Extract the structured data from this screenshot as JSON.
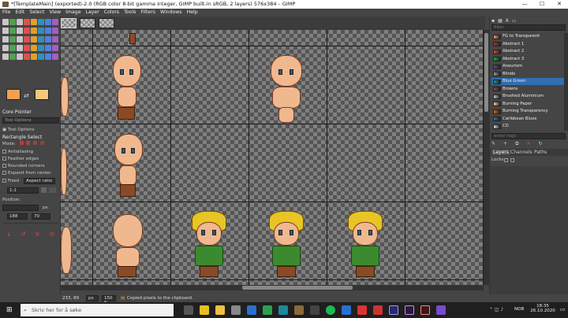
{
  "window": {
    "title": "*[TemplateMain] (exported)-2.0 (RGB color 8-bit gamma integer, GIMP built-in sRGB, 2 layers) 576x384 – GIMP",
    "minimize": "—",
    "maximize": "☐",
    "close": "✕"
  },
  "menu": [
    "File",
    "Edit",
    "Select",
    "View",
    "Image",
    "Layer",
    "Colors",
    "Tools",
    "Filters",
    "Windows",
    "Help"
  ],
  "toolbox": {
    "pointer_header": "Core Pointer",
    "tool_options_field": "Tool Options",
    "tool_options_label": "Tool Options",
    "section_title": "Rectangle Select",
    "mode_label": "Mode:",
    "options": [
      "Antialiasing",
      "Feather edges",
      "Rounded corners",
      "Expand from center"
    ],
    "fixed_label": "Fixed",
    "fixed_value": "Aspect ratio",
    "ratio_value": "1:1",
    "position_label": "Position:",
    "position_unit": "px",
    "position_x": "188",
    "position_y": "70",
    "fg_color": "#f0a050",
    "bg_color": "#f5c77e"
  },
  "gradients": {
    "filter_placeholder": "filter",
    "items": [
      {
        "name": "FG to Transparent",
        "sw": "#f5a050"
      },
      {
        "name": "Abstract 1",
        "sw": "#b03040"
      },
      {
        "name": "Abstract 2",
        "sw": "#d05020"
      },
      {
        "name": "Abstract 3",
        "sw": "#30a040"
      },
      {
        "name": "Aneurism",
        "sw": "#704090"
      },
      {
        "name": "Blinds",
        "sw": "#999999"
      },
      {
        "name": "Blue Green",
        "sw": "#2090a0"
      },
      {
        "name": "Browns",
        "sw": "#805030"
      },
      {
        "name": "Brushed Aluminium",
        "sw": "#c0c0c0"
      },
      {
        "name": "Burning Paper",
        "sw": "#e0d0b0"
      },
      {
        "name": "Burning Transparency",
        "sw": "#e06020"
      },
      {
        "name": "Caribbean Blues",
        "sw": "#3070c0"
      },
      {
        "name": "CD",
        "sw": "#d0d0e0"
      }
    ],
    "tag_placeholder": "enter tags"
  },
  "layers_panel": {
    "tabs": [
      "Layers",
      "Channels",
      "Paths"
    ],
    "locks_label": "Locks:"
  },
  "status": {
    "coords": "233, 89",
    "unit": "px",
    "zoom": "150 %",
    "message": "Copied pixels to the clipboard."
  },
  "taskbar": {
    "search_placeholder": "Skriv her for å søke",
    "language": "NOB",
    "time": "18:35",
    "date": "26.10.2020"
  }
}
